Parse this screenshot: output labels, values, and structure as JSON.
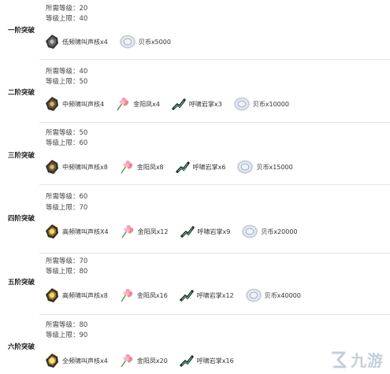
{
  "stages": [
    {
      "label": "一阶突破",
      "level_req": "所需等级：20",
      "level_cap": "等级上限：40",
      "items": [
        {
          "icon": "core-gray-icon",
          "text": "低频啸叫声核x4"
        },
        {
          "icon": "shell-coin-icon",
          "text": "贝币x5000"
        }
      ]
    },
    {
      "label": "二阶突破",
      "level_req": "所需等级：40",
      "level_cap": "等级上限：50",
      "items": [
        {
          "icon": "core-bronze-icon",
          "text": "中频啸叫声核4"
        },
        {
          "icon": "flower-icon",
          "text": "金阳凤x4"
        },
        {
          "icon": "claw-icon",
          "text": "呼啸岩掌x3"
        },
        {
          "icon": "shell-coin-icon",
          "text": "贝币x10000"
        }
      ]
    },
    {
      "label": "三阶突破",
      "level_req": "所需等级：50",
      "level_cap": "等级上限：60",
      "items": [
        {
          "icon": "core-bronze-icon",
          "text": "中频啸叫声核x8"
        },
        {
          "icon": "flower-icon",
          "text": "金阳凤x8"
        },
        {
          "icon": "claw-icon",
          "text": "呼啸岩掌x6"
        },
        {
          "icon": "shell-coin-icon",
          "text": "贝币x15000"
        }
      ]
    },
    {
      "label": "四阶突破",
      "level_req": "所需等级：60",
      "level_cap": "等级上限：70",
      "items": [
        {
          "icon": "core-gold-icon",
          "text": "高频啸叫声核X4"
        },
        {
          "icon": "flower-icon",
          "text": "金阳凤x12"
        },
        {
          "icon": "claw-icon",
          "text": "呼啸岩掌x9"
        },
        {
          "icon": "shell-coin-icon",
          "text": "贝币x20000"
        }
      ]
    },
    {
      "label": "五阶突破",
      "level_req": "所需等级：70",
      "level_cap": "等级上限：80",
      "items": [
        {
          "icon": "core-gold-icon",
          "text": "高频啸叫声核x8"
        },
        {
          "icon": "flower-icon",
          "text": "金阳凤x16"
        },
        {
          "icon": "claw-icon",
          "text": "呼啸岩掌x12"
        },
        {
          "icon": "shell-coin-icon",
          "text": "贝币x40000"
        }
      ]
    },
    {
      "label": "六阶突破",
      "level_req": "所需等级：80",
      "level_cap": "等级上限：90",
      "items": [
        {
          "icon": "core-gold-icon",
          "text": "全频啸叫声核x4"
        },
        {
          "icon": "flower-icon",
          "text": "金阳凤x20"
        },
        {
          "icon": "claw-icon",
          "text": "呼啸岩掌x16"
        }
      ]
    }
  ],
  "watermark": {
    "text": "九游",
    "icon": "jiuyou-logo-icon"
  }
}
